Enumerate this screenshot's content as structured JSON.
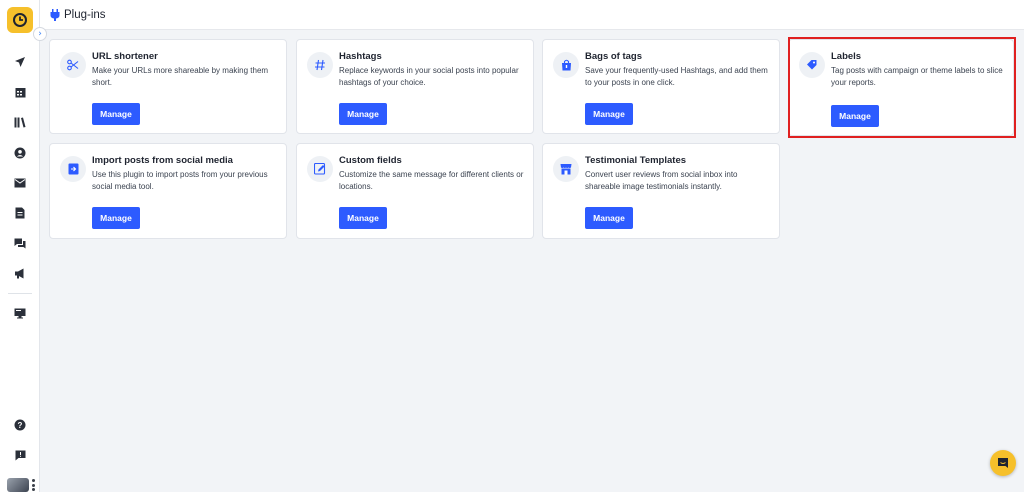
{
  "app": {
    "page_title": "Plug-ins",
    "accent_color": "#2d5bff",
    "logo_color": "#f6c02b"
  },
  "sidebar": {
    "items": [
      {
        "icon": "send-icon"
      },
      {
        "icon": "calendar-icon"
      },
      {
        "icon": "library-icon"
      },
      {
        "icon": "user-icon"
      },
      {
        "icon": "mail-icon"
      },
      {
        "icon": "document-icon"
      },
      {
        "icon": "chat-icon"
      },
      {
        "icon": "megaphone-icon"
      },
      {
        "icon": "monitor-icon"
      },
      {
        "icon": "help-icon"
      },
      {
        "icon": "feedback-icon"
      }
    ]
  },
  "plugins": [
    {
      "title": "URL shortener",
      "description": "Make your URLs more shareable by making them short.",
      "button": "Manage",
      "icon": "scissors-icon"
    },
    {
      "title": "Hashtags",
      "description": "Replace keywords in your social posts into popular hashtags of your choice.",
      "button": "Manage",
      "icon": "hash-icon"
    },
    {
      "title": "Bags of tags",
      "description": "Save your frequently-used Hashtags, and add them to your posts in one click.",
      "button": "Manage",
      "icon": "bag-icon"
    },
    {
      "title": "Labels",
      "description": "Tag posts with campaign or theme labels to slice your reports.",
      "button": "Manage",
      "icon": "tag-icon"
    },
    {
      "title": "Import posts from social media",
      "description": "Use this plugin to import posts from your previous social media tool.",
      "button": "Manage",
      "icon": "import-icon"
    },
    {
      "title": "Custom fields",
      "description": "Customize the same message for different clients or locations.",
      "button": "Manage",
      "icon": "edit-field-icon"
    },
    {
      "title": "Testimonial Templates",
      "description": "Convert user reviews from social inbox into shareable image testimonials instantly.",
      "button": "Manage",
      "icon": "store-icon"
    }
  ]
}
